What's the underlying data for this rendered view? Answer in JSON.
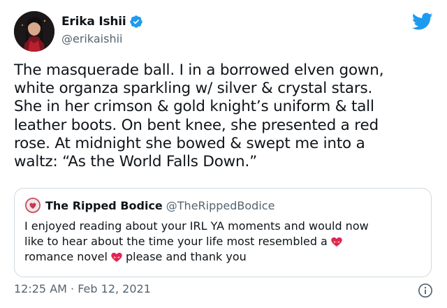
{
  "author": {
    "display_name": "Erika Ishii",
    "handle": "@erikaishii",
    "verified": true,
    "avatar_icon": "profile-photo"
  },
  "tweet": {
    "lines": [
      "The masquerade ball. I in a borrowed elven gown,",
      "white organza sparkling w/ silver & crystal stars.",
      "She in her crimson & gold knight’s uniform & tall",
      "leather boots. On bent knee, she presented a red",
      "rose. At midnight she bowed & swept me into a",
      "waltz: “As the World Falls Down.”"
    ],
    "time": "12:25 AM",
    "separator": " · ",
    "date": "Feb 12, 2021"
  },
  "quoted_tweet": {
    "display_name": "The Ripped Bodice",
    "handle": "@TheRippedBodice",
    "line1": "I enjoyed reading about your IRL YA  moments and would now",
    "line2": "like to hear about the time your life most resembled a",
    "line3a": "romance novel",
    "line3b": "please and thank you",
    "emoji": "heart-with-ribbon-icon"
  },
  "icons": {
    "brand": "twitter-bird-icon",
    "verified": "verified-badge-icon",
    "info": "info-icon"
  },
  "colors": {
    "brand_blue": "#1d9bf0",
    "text_primary": "#0f1419",
    "text_secondary": "#536471",
    "border": "#cfd9de",
    "heart_pink": "#e0245e"
  }
}
